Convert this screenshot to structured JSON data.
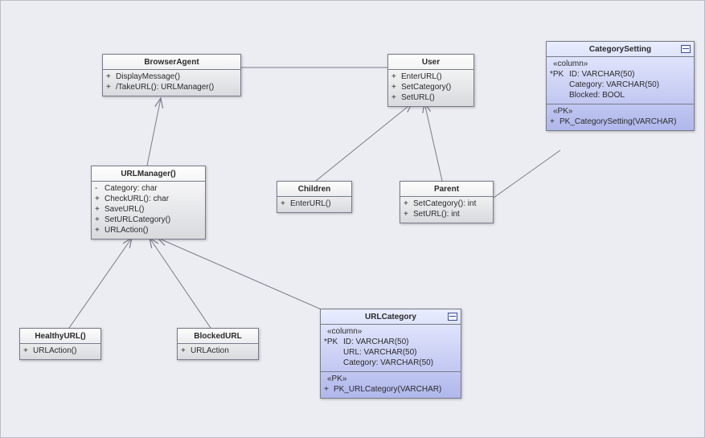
{
  "nodes": {
    "browserAgent": {
      "title": "BrowserAgent",
      "ops": [
        {
          "vis": "+",
          "txt": "DisplayMessage()"
        },
        {
          "vis": "+",
          "txt": "/TakeURL(): URLManager()"
        }
      ]
    },
    "user": {
      "title": "User",
      "ops": [
        {
          "vis": "+",
          "txt": "EnterURL()"
        },
        {
          "vis": "+",
          "txt": "SetCategory()"
        },
        {
          "vis": "+",
          "txt": "SetURL()"
        }
      ]
    },
    "categorySetting": {
      "title": "CategorySetting",
      "colHeader": "«column»",
      "cols": [
        {
          "vis": "*PK",
          "txt": "ID: VARCHAR(50)"
        },
        {
          "vis": "",
          "txt": "Category: VARCHAR(50)"
        },
        {
          "vis": "",
          "txt": "Blocked: BOOL"
        }
      ],
      "pkHeader": "«PK»",
      "pks": [
        {
          "vis": "+",
          "txt": "PK_CategorySetting(VARCHAR)"
        }
      ]
    },
    "urlManager": {
      "title": "URLManager()",
      "ops": [
        {
          "vis": "-",
          "txt": "Category: char"
        },
        {
          "vis": "+",
          "txt": "CheckURL(): char"
        },
        {
          "vis": "+",
          "txt": "SaveURL()"
        },
        {
          "vis": "+",
          "txt": "SetURLCategory()"
        },
        {
          "vis": "+",
          "txt": "URLAction()"
        }
      ]
    },
    "children": {
      "title": "Children",
      "ops": [
        {
          "vis": "+",
          "txt": "EnterURL()"
        }
      ]
    },
    "parent": {
      "title": "Parent",
      "ops": [
        {
          "vis": "+",
          "txt": "SetCategory(): int"
        },
        {
          "vis": "+",
          "txt": "SetURL(): int"
        }
      ]
    },
    "healthyURL": {
      "title": "HealthyURL()",
      "ops": [
        {
          "vis": "+",
          "txt": "URLAction()"
        }
      ]
    },
    "blockedURL": {
      "title": "BlockedURL",
      "ops": [
        {
          "vis": "+",
          "txt": "URLAction"
        }
      ]
    },
    "urlCategory": {
      "title": "URLCategory",
      "colHeader": "«column»",
      "cols": [
        {
          "vis": "*PK",
          "txt": "ID: VARCHAR(50)"
        },
        {
          "vis": "",
          "txt": "URL: VARCHAR(50)"
        },
        {
          "vis": "",
          "txt": "Category: VARCHAR(50)"
        }
      ],
      "pkHeader": "«PK»",
      "pks": [
        {
          "vis": "+",
          "txt": "PK_URLCategory(VARCHAR)"
        }
      ]
    }
  }
}
